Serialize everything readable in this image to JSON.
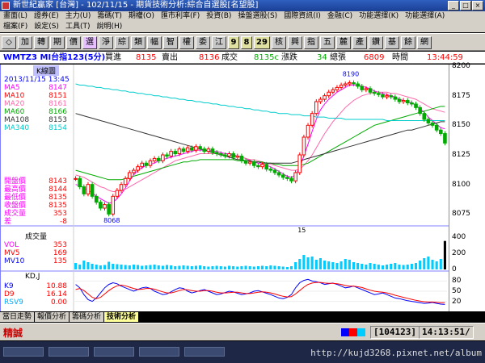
{
  "window": {
    "title": "新世紀贏家 [台灣] - 102/11/15 - 期貨技術分析:綜合自選股[名望股]"
  },
  "menu1": [
    "畫面(L)",
    "證券(E)",
    "主力(U)",
    "籌碼(T)",
    "期權(O)",
    "匯市利率(F)",
    "投資(B)",
    "操盤選股(S)",
    "國際資訊(I)",
    "金融(C)",
    "功能選擇(K)",
    "功能選擇(A)"
  ],
  "menu2": [
    "檔案(F)",
    "設定(S)",
    "工具(T)",
    "說明(H)"
  ],
  "toolbar": [
    "◇",
    "加",
    "轉",
    "期",
    "價",
    "選",
    "淨",
    "綜",
    "類",
    "幅",
    "智",
    "權",
    "委",
    "江",
    "9",
    "8",
    "29",
    "核",
    "興",
    "指",
    "五",
    "麓",
    "產",
    "鑽",
    "基",
    "餘",
    "網"
  ],
  "info": {
    "symbol": "WMTZ3 MI台指123(5分)",
    "bid_label": "買進",
    "bid": "8135",
    "ask_label": "賣出",
    "ask": "8136",
    "trade_label": "成交",
    "trade": "8135c",
    "change_label": "漲跌",
    "change": "34",
    "change_note": "總張",
    "volume": "6809",
    "time_label": "時間",
    "time": "13:44:59"
  },
  "kline": {
    "title": "K線圖",
    "datetime": "2013/11/15 13:45",
    "ma": [
      {
        "label": "MA5",
        "value": "8147",
        "color": "#ff00ff"
      },
      {
        "label": "MA10",
        "value": "8151",
        "color": "#ff0000"
      },
      {
        "label": "MA20",
        "value": "8161",
        "color": "#ff66aa"
      },
      {
        "label": "MA60",
        "value": "8166",
        "color": "#00aa00"
      },
      {
        "label": "MA108",
        "value": "8153",
        "color": "#333333"
      },
      {
        "label": "MA340",
        "value": "8154",
        "color": "#00cccc"
      }
    ],
    "stats": [
      {
        "label": "開盤價",
        "value": "8143"
      },
      {
        "label": "最高價",
        "value": "8144"
      },
      {
        "label": "最低價",
        "value": "8135"
      },
      {
        "label": "收盤價",
        "value": "8135"
      },
      {
        "label": "成交量",
        "value": "353"
      },
      {
        "label": "差",
        "value": "-8"
      }
    ],
    "high_mark": "8190",
    "low_mark": "8068",
    "x_label": "15",
    "y_ticks": [
      "8200",
      "8175",
      "8150",
      "8125",
      "8100",
      "8075"
    ]
  },
  "volume": {
    "title": "成交量",
    "rows": [
      {
        "label": "VOL",
        "value": "353",
        "color": "#ff00ff"
      },
      {
        "label": "MV5",
        "value": "169",
        "color": "#ff0000"
      },
      {
        "label": "MV10",
        "value": "135",
        "color": "#0000ff"
      }
    ],
    "y_ticks": [
      "400",
      "200",
      "0"
    ]
  },
  "kd": {
    "title": "KD,J",
    "rows": [
      {
        "label": "K9",
        "value": "10.88",
        "color": "#0000ff"
      },
      {
        "label": "D9",
        "value": "16.14",
        "color": "#ff0000"
      },
      {
        "label": "RSV9",
        "value": "0.00",
        "color": "#00aaff"
      }
    ],
    "y_ticks": [
      "80",
      "50",
      "20"
    ]
  },
  "tabs": [
    "當日走勢",
    "報價分析",
    "籌碼分析",
    "技術分析"
  ],
  "status": {
    "mode": "精誠",
    "code": "104123",
    "clock": "14:13:51"
  },
  "url": "http://kujd3268.pixnet.net/album",
  "chart_data": {
    "type": "candlestick",
    "ylim": [
      8065,
      8200
    ],
    "closes": [
      8105,
      8098,
      8092,
      8100,
      8090,
      8085,
      8080,
      8083,
      8075,
      8090,
      8095,
      8100,
      8105,
      8110,
      8112,
      8115,
      8118,
      8116,
      8120,
      8122,
      8120,
      8125,
      8124,
      8128,
      8126,
      8130,
      8128,
      8131,
      8129,
      8132,
      8130,
      8128,
      8130,
      8127,
      8126,
      8125,
      8124,
      8126,
      8123,
      8124,
      8120,
      8118,
      8119,
      8116,
      8115,
      8117,
      8113,
      8112,
      8110,
      8108,
      8106,
      8105,
      8103,
      8110,
      8125,
      8140,
      8150,
      8160,
      8170,
      8172,
      8175,
      8178,
      8180,
      8182,
      8184,
      8185,
      8186,
      8185,
      8183,
      8180,
      8181,
      8178,
      8177,
      8176,
      8174,
      8175,
      8174,
      8172,
      8170,
      8171,
      8169,
      8168,
      8165,
      8160,
      8155,
      8152,
      8150,
      8146,
      8143,
      8135
    ],
    "volume": [
      80,
      60,
      110,
      90,
      70,
      60,
      50,
      55,
      95,
      70,
      65,
      60,
      55,
      50,
      60,
      55,
      45,
      50,
      55,
      60,
      50,
      45,
      55,
      50,
      40,
      45,
      50,
      45,
      40,
      45,
      50,
      40,
      35,
      40,
      45,
      40,
      35,
      45,
      40,
      35,
      40,
      45,
      40,
      35,
      40,
      45,
      40,
      50,
      45,
      40,
      35,
      30,
      40,
      90,
      130,
      180,
      150,
      160,
      120,
      140,
      110,
      100,
      90,
      80,
      100,
      130,
      120,
      90,
      80,
      70,
      60,
      80,
      70,
      60,
      50,
      60,
      70,
      80,
      60,
      55,
      60,
      70,
      80,
      110,
      140,
      160,
      120,
      100,
      130,
      353
    ],
    "k": [
      70,
      60,
      40,
      25,
      20,
      30,
      45,
      60,
      70,
      75,
      72,
      65,
      60,
      55,
      50,
      55,
      60,
      62,
      58,
      50,
      45,
      40,
      42,
      48,
      55,
      60,
      58,
      50,
      45,
      48,
      52,
      55,
      50,
      45,
      40,
      42,
      46,
      50,
      48,
      44,
      40,
      42,
      45,
      50,
      52,
      48,
      44,
      40,
      35,
      30,
      28,
      32,
      40,
      60,
      75,
      82,
      85,
      80,
      78,
      75,
      70,
      72,
      74,
      70,
      65,
      60,
      62,
      65,
      60,
      55,
      50,
      45,
      40,
      42,
      45,
      40,
      35,
      30,
      28,
      25,
      22,
      20,
      18,
      16,
      14,
      15,
      17,
      14,
      12,
      10.88
    ],
    "d": [
      55,
      58,
      52,
      42,
      32,
      28,
      32,
      42,
      52,
      60,
      66,
      68,
      66,
      62,
      58,
      55,
      56,
      58,
      58,
      56,
      52,
      48,
      45,
      45,
      48,
      52,
      55,
      54,
      52,
      50,
      50,
      52,
      52,
      50,
      47,
      45,
      45,
      46,
      47,
      47,
      45,
      43,
      43,
      45,
      47,
      48,
      47,
      45,
      42,
      38,
      35,
      33,
      34,
      42,
      52,
      62,
      70,
      74,
      76,
      76,
      74,
      73,
      73,
      72,
      70,
      67,
      65,
      65,
      63,
      61,
      57,
      53,
      50,
      48,
      47,
      45,
      42,
      38,
      35,
      32,
      29,
      26,
      23,
      21,
      19,
      18,
      18,
      17,
      16,
      16.14
    ],
    "ma_curves": {
      "MA5": [
        8100,
        8099,
        8097,
        8095,
        8093,
        8090,
        8088,
        8086,
        8084,
        8085,
        8088,
        8092,
        8097,
        8103,
        8108,
        8112,
        8114,
        8116,
        8117,
        8118,
        8120,
        8121,
        8122,
        8123,
        8124,
        8125,
        8126,
        8127,
        8128,
        8129,
        8129,
        8129,
        8129,
        8128,
        8128,
        8127,
        8126,
        8126,
        8125,
        8124,
        8123,
        8122,
        8120,
        8119,
        8118,
        8117,
        8116,
        8115,
        8113,
        8111,
        8109,
        8107,
        8106,
        8108,
        8114,
        8124,
        8134,
        8145,
        8155,
        8163,
        8168,
        8172,
        8175,
        8178,
        8180,
        8182,
        8184,
        8184,
        8184,
        8183,
        8182,
        8181,
        8179,
        8178,
        8177,
        8176,
        8175,
        8174,
        8172,
        8171,
        8170,
        8169,
        8167,
        8164,
        8161,
        8157,
        8154,
        8151,
        8148,
        8147
      ],
      "MA20": [
        8108,
        8107,
        8106,
        8104,
        8102,
        8100,
        8098,
        8097,
        8095,
        8094,
        8094,
        8095,
        8096,
        8098,
        8100,
        8102,
        8104,
        8106,
        8108,
        8110,
        8112,
        8114,
        8116,
        8118,
        8120,
        8121,
        8122,
        8123,
        8124,
        8125,
        8126,
        8126,
        8126,
        8126,
        8126,
        8126,
        8125,
        8125,
        8124,
        8124,
        8123,
        8122,
        8121,
        8121,
        8120,
        8119,
        8118,
        8117,
        8116,
        8115,
        8114,
        8113,
        8112,
        8112,
        8113,
        8116,
        8120,
        8125,
        8131,
        8137,
        8143,
        8148,
        8153,
        8157,
        8161,
        8165,
        8168,
        8171,
        8173,
        8175,
        8176,
        8177,
        8178,
        8178,
        8178,
        8178,
        8177,
        8177,
        8176,
        8175,
        8174,
        8173,
        8172,
        8170,
        8168,
        8166,
        8164,
        8163,
        8162,
        8161
      ],
      "MA60": [
        8112,
        8111,
        8110,
        8109,
        8108,
        8107,
        8106,
        8105,
        8104,
        8104,
        8104,
        8104,
        8105,
        8106,
        8107,
        8108,
        8109,
        8110,
        8111,
        8112,
        8113,
        8114,
        8115,
        8116,
        8117,
        8118,
        8119,
        8119,
        8120,
        8120,
        8121,
        8121,
        8121,
        8121,
        8121,
        8121,
        8121,
        8121,
        8121,
        8120,
        8120,
        8120,
        8120,
        8119,
        8119,
        8119,
        8118,
        8118,
        8117,
        8117,
        8116,
        8116,
        8116,
        8116,
        8116,
        8117,
        8118,
        8120,
        8122,
        8124,
        8126,
        8128,
        8130,
        8132,
        8134,
        8136,
        8138,
        8140,
        8142,
        8144,
        8146,
        8148,
        8150,
        8151,
        8152,
        8153,
        8154,
        8155,
        8156,
        8157,
        8158,
        8159,
        8160,
        8161,
        8162,
        8163,
        8164,
        8165,
        8166,
        8166
      ],
      "MA108": [
        8160,
        8159,
        8158,
        8157,
        8156,
        8155,
        8154,
        8153,
        8152,
        8151,
        8150,
        8149,
        8148,
        8147,
        8146,
        8145,
        8144,
        8143,
        8142,
        8141,
        8140,
        8139,
        8138,
        8137,
        8136,
        8135,
        8134,
        8133,
        8132,
        8131,
        8130,
        8129,
        8128,
        8127,
        8126,
        8125,
        8124,
        8123,
        8122,
        8121,
        8121,
        8120,
        8120,
        8119,
        8119,
        8118,
        8118,
        8118,
        8118,
        8118,
        8118,
        8118,
        8118,
        8119,
        8120,
        8121,
        8122,
        8123,
        8124,
        8125,
        8126,
        8127,
        8128,
        8129,
        8130,
        8131,
        8132,
        8133,
        8134,
        8135,
        8136,
        8137,
        8138,
        8139,
        8140,
        8141,
        8142,
        8143,
        8144,
        8145,
        8146,
        8146,
        8147,
        8148,
        8149,
        8150,
        8151,
        8152,
        8153,
        8153
      ],
      "MA340": [
        8185,
        8184,
        8184,
        8183,
        8183,
        8182,
        8182,
        8181,
        8181,
        8180,
        8180,
        8179,
        8179,
        8178,
        8178,
        8177,
        8177,
        8176,
        8176,
        8175,
        8175,
        8174,
        8174,
        8173,
        8173,
        8172,
        8172,
        8171,
        8171,
        8170,
        8170,
        8169,
        8169,
        8168,
        8168,
        8167,
        8167,
        8166,
        8166,
        8165,
        8165,
        8164,
        8164,
        8163,
        8163,
        8162,
        8162,
        8161,
        8161,
        8160,
        8160,
        8160,
        8159,
        8159,
        8159,
        8158,
        8158,
        8158,
        8157,
        8157,
        8157,
        8156,
        8156,
        8156,
        8156,
        8155,
        8155,
        8155,
        8155,
        8155,
        8155,
        8155,
        8155,
        8155,
        8155,
        8154,
        8154,
        8154,
        8154,
        8154,
        8154,
        8154,
        8154,
        8154,
        8154,
        8154,
        8154,
        8154,
        8154,
        8154
      ]
    }
  }
}
